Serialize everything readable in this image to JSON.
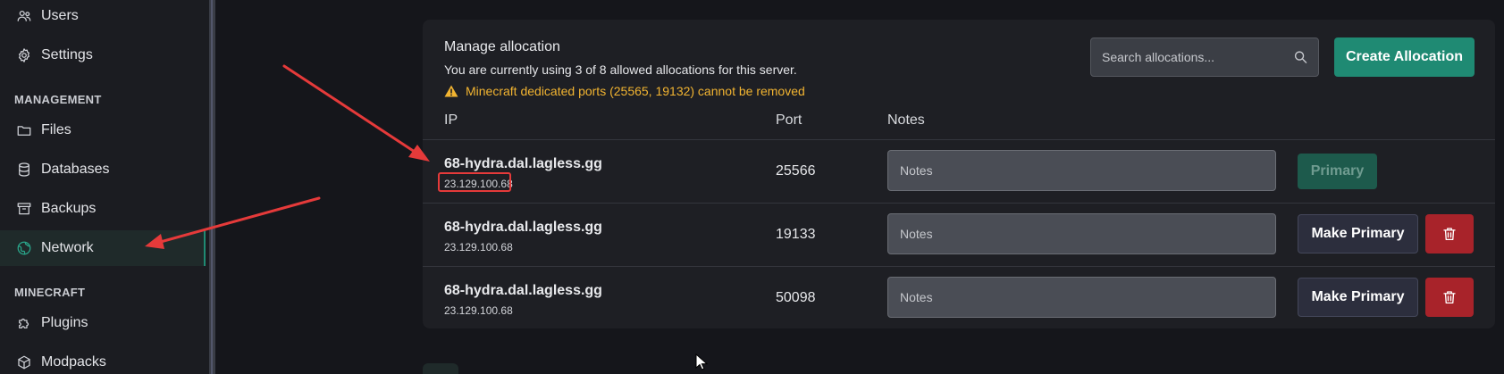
{
  "sidebar": {
    "items_top": [
      {
        "label": "Users",
        "icon": "users-icon"
      },
      {
        "label": "Settings",
        "icon": "gear-icon"
      }
    ],
    "sections": [
      {
        "title": "MANAGEMENT",
        "items": [
          {
            "label": "Files",
            "icon": "folder-icon"
          },
          {
            "label": "Databases",
            "icon": "database-icon"
          },
          {
            "label": "Backups",
            "icon": "archive-icon"
          },
          {
            "label": "Network",
            "icon": "globe-icon",
            "active": true
          }
        ]
      },
      {
        "title": "MINECRAFT",
        "items": [
          {
            "label": "Plugins",
            "icon": "puzzle-icon"
          },
          {
            "label": "Modpacks",
            "icon": "package-icon"
          }
        ]
      }
    ]
  },
  "allocation": {
    "title": "Manage allocation",
    "subtitle": "You are currently using 3 of 8 allowed allocations for this server.",
    "warning": "Minecraft dedicated ports (25565, 19132) cannot be removed",
    "search_placeholder": "Search allocations...",
    "create_label": "Create Allocation",
    "columns": {
      "ip": "IP",
      "port": "Port",
      "notes": "Notes"
    },
    "notes_placeholder": "Notes",
    "primary_label": "Primary",
    "make_primary_label": "Make Primary",
    "rows": [
      {
        "hostname": "68-hydra.dal.lagless.gg",
        "ip": "23.129.100.68",
        "port": "25566",
        "is_primary": true
      },
      {
        "hostname": "68-hydra.dal.lagless.gg",
        "ip": "23.129.100.68",
        "port": "19133",
        "is_primary": false
      },
      {
        "hostname": "68-hydra.dal.lagless.gg",
        "ip": "23.129.100.68",
        "port": "50098",
        "is_primary": false
      }
    ]
  },
  "colors": {
    "accent": "#1f8a73",
    "warning": "#f2b431",
    "danger": "#a8232a",
    "annotation": "#e53a3a"
  }
}
